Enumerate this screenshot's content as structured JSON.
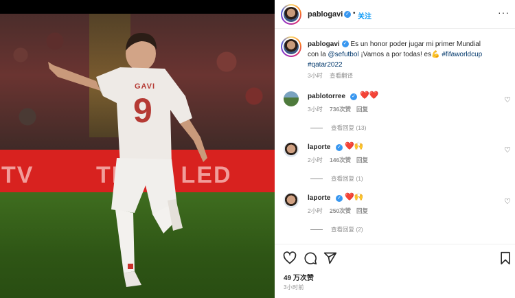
{
  "photo": {
    "jersey_name": "GAVI",
    "jersey_number": "9",
    "ad_left": "TV",
    "ad_right": "TE  Mi LED"
  },
  "header": {
    "username": "pablogavi",
    "separator": "•",
    "follow_label": "关注",
    "more": "···"
  },
  "caption": {
    "username": "pablogavi",
    "text_1": " Es un honor poder jugar mi primer Mundial con la ",
    "mention": "@sefutbol",
    "text_2": " ¡Vamos a por todas! es",
    "hashtag1": "#fifaworldcup",
    "hashtag2": "#qatar2022",
    "time": "3小时",
    "translate": "查看翻译"
  },
  "comments": [
    {
      "username": "pablotorree",
      "emoji": "❤️❤️",
      "time": "3小时",
      "likes": "736次赞",
      "reply": "回复",
      "view_replies": "查看回复 (13)"
    },
    {
      "username": "laporte",
      "emoji": "❤️🙌",
      "time": "2小时",
      "likes": "146次赞",
      "reply": "回复",
      "view_replies": "查看回复 (1)"
    },
    {
      "username": "laporte",
      "emoji": "❤️🙌",
      "time": "2小时",
      "likes": "250次赞",
      "reply": "回复",
      "view_replies": "查看回复 (2)"
    }
  ],
  "footer": {
    "likes": "49 万次赞",
    "time": "3小时前"
  },
  "colors": {
    "accent": "#0095f6",
    "verified": "#3897f0",
    "heart": "#ed4956",
    "ad_red": "#d8221f"
  }
}
